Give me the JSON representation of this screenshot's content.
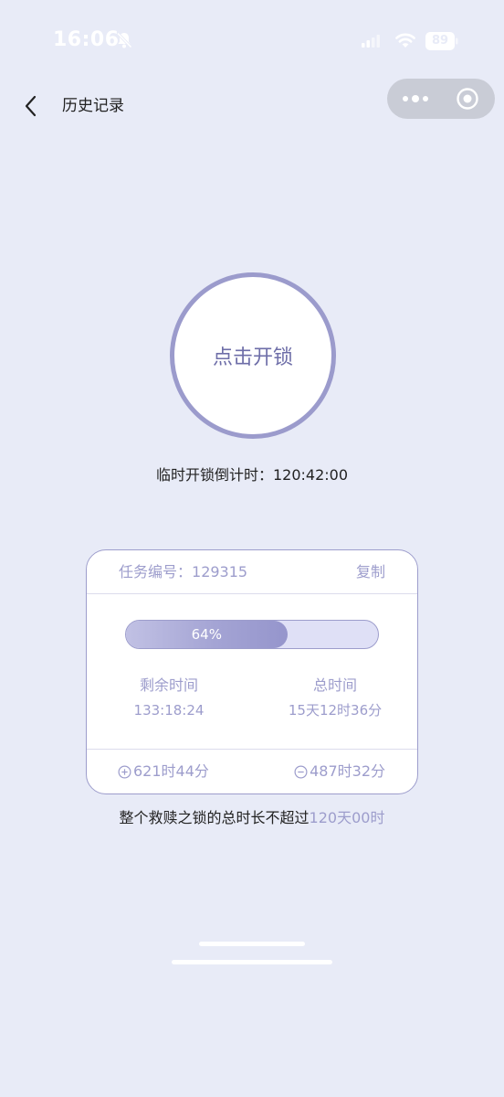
{
  "status_bar": {
    "time": "16:06",
    "battery": "89",
    "icons": [
      "bell-slash-icon",
      "signal-icon",
      "wifi-icon",
      "battery-icon"
    ]
  },
  "nav": {
    "title": "历史记录",
    "back_icon": "chevron-left-icon",
    "capsule_icons": [
      "more-dots-icon",
      "close-circle-icon"
    ]
  },
  "unlock": {
    "button_label": "点击开锁",
    "countdown_label": "临时开锁倒计时：",
    "countdown_value": "120:42:00"
  },
  "task": {
    "id_label": "任务编号：",
    "id_value": "129315",
    "copy_label": "复制",
    "progress_label": "64%",
    "progress_value": 0.64,
    "remaining_label": "剩余时间",
    "remaining_value": "133:18:24",
    "total_label": "总时间",
    "total_value": "15天12时36分",
    "added_value": "621时44分",
    "reduced_value": "487时32分",
    "added_icon": "plus-circle-icon",
    "reduced_icon": "minus-circle-icon"
  },
  "limit_note": {
    "text": "整个救赎之锁的总时长不超过",
    "value": "120天00时"
  },
  "colors": {
    "background": "#e8ebf7",
    "accent": "#9d9dcc",
    "text": "#222222"
  }
}
